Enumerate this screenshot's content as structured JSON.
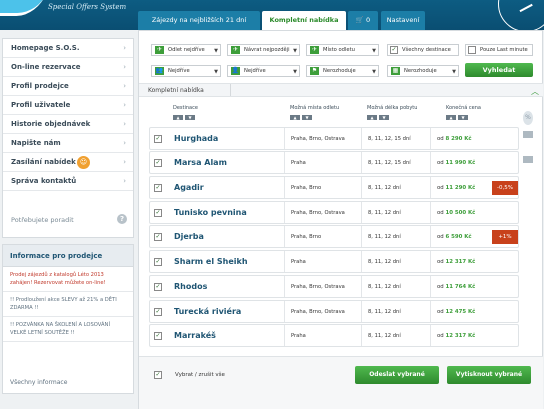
{
  "header": {
    "subtitle": "Special Offers System",
    "tabs": [
      "Zájezdy na nejbližších 21 dní",
      "Kompletní nabídka",
      "0",
      "Nastavení"
    ]
  },
  "sidebar": {
    "items": [
      "Homepage S.O.S.",
      "On-line rezervace",
      "Profil prodejce",
      "Profil uživatele",
      "Historie objednávek",
      "Napište nám",
      "Zasílání nabídek",
      "Správa kontaktů"
    ],
    "help": "Potřebujete poradit",
    "help_icon": "?",
    "arrow": "›"
  },
  "info": {
    "title": "Informace pro prodejce",
    "blocks": [
      "Prodej zájezdů z katalogů Léto 2013 zahájen! Rezervovat můžete on-line!",
      "!! Prodloužení akce SLEVY až 21% a DĚTI ZDARMA !!",
      "!! POZVÁNKA NA ŠKOLENÍ A LOSOVÁNÍ VELKÉ LETNÍ SOUTĚŽE !!"
    ],
    "more": "Všechny informace"
  },
  "filters": {
    "r1": [
      "Odlet nejdříve",
      "Návrat nejpozději",
      "Místo odletu",
      "Všechny destinace",
      "Pouze Last minute"
    ],
    "r2": [
      "Nejdříve",
      "Nejdříve",
      "Nerozhoduje",
      "Nerozhoduje"
    ],
    "search": "Vyhledat"
  },
  "crumb": "Kompletní nabídka",
  "table": {
    "headers": [
      "Destinace",
      "Možná místa odletu",
      "Možná délka pobytu",
      "Konečná cena"
    ],
    "rows": [
      {
        "dest": "Hurghada",
        "ap": "Praha, Brno, Ostrava",
        "len": "8, 11, 12, 15 dní",
        "price_pre": "od ",
        "price": "8 290 Kč",
        "badge": ""
      },
      {
        "dest": "Marsa Alam",
        "ap": "Praha",
        "len": "8, 11, 12, 15 dní",
        "price_pre": "od ",
        "price": "11 990 Kč",
        "badge": ""
      },
      {
        "dest": "Agadir",
        "ap": "Praha, Brno",
        "len": "8, 11, 12 dní",
        "price_pre": "od ",
        "price": "11 290 Kč",
        "badge": "-0,5%"
      },
      {
        "dest": "Tunisko pevnina",
        "ap": "Praha, Brno, Ostrava",
        "len": "8, 11, 12 dní",
        "price_pre": "od ",
        "price": "10 500 Kč",
        "badge": ""
      },
      {
        "dest": "Djerba",
        "ap": "Praha, Brno",
        "len": "8, 11, 12 dní",
        "price_pre": "od ",
        "price": "6 590 Kč",
        "badge": "+1%"
      },
      {
        "dest": "Sharm el Sheikh",
        "ap": "Praha",
        "len": "8, 11, 12 dní",
        "price_pre": "od ",
        "price": "12 317 Kč",
        "badge": ""
      },
      {
        "dest": "Rhodos",
        "ap": "Praha, Brno, Ostrava",
        "len": "8, 11, 12 dní",
        "price_pre": "od ",
        "price": "11 764 Kč",
        "badge": ""
      },
      {
        "dest": "Turecká riviéra",
        "ap": "Praha, Brno, Ostrava",
        "len": "8, 11, 12 dní",
        "price_pre": "od ",
        "price": "12 475 Kč",
        "badge": ""
      },
      {
        "dest": "Marrakéš",
        "ap": "Praha",
        "len": "8, 11, 12 dní",
        "price_pre": "od ",
        "price": "12 317 Kč",
        "badge": ""
      }
    ]
  },
  "footer": {
    "select_all": "Vybrat / zrušit vše",
    "send": "Odeslat vybrané",
    "print": "Vytisknout vybrané"
  },
  "colors": {
    "green": "#3d9e3a",
    "header": "#0d5c82",
    "badge": "#c8411b"
  }
}
